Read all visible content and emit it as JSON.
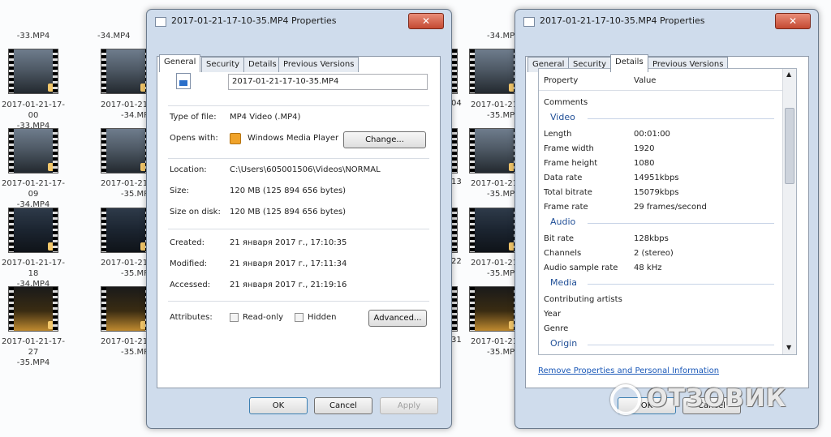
{
  "background": {
    "left_labels": [
      [
        "-33.MP4"
      ],
      [
        "2017-01-21-17-00",
        "-33.MP4"
      ],
      [
        "2017-01-21-17-09",
        "-34.MP4"
      ],
      [
        "2017-01-21-17-18",
        "-34.MP4"
      ],
      [
        "2017-01-21-17-27",
        "-35.MP4"
      ]
    ],
    "col2_labels": [
      [
        "-34.MP4"
      ],
      [
        "2017-01-21",
        "-34.MP"
      ],
      [
        "2017-01-21",
        "-35.MP"
      ],
      [
        "2017-01-21",
        "-35.MP"
      ],
      [
        "2017-01-21",
        "-35.MP"
      ]
    ],
    "mid_fragments": [
      "04",
      "13",
      "22",
      "31"
    ],
    "right_labels": [
      [
        "-34.MP"
      ],
      [
        "2017-01-21",
        "-35.MP"
      ],
      [
        "2017-01-21",
        "-35.MP"
      ],
      [
        "2017-01-21",
        "-35.MP"
      ],
      [
        "2017-01-21",
        "-35.MP"
      ]
    ]
  },
  "general_dialog": {
    "title": "2017-01-21-17-10-35.MP4 Properties",
    "close_glyph": "✕",
    "tabs": [
      "General",
      "Security",
      "Details",
      "Previous Versions"
    ],
    "filename": "2017-01-21-17-10-35.MP4",
    "type_label": "Type of file:",
    "type_value": "MP4 Video (.MP4)",
    "opens_label": "Opens with:",
    "opens_value": "Windows Media Player",
    "change_button": "Change...",
    "location_label": "Location:",
    "location_value": "C:\\Users\\605001506\\Videos\\NORMAL",
    "size_label": "Size:",
    "size_value": "120 MB (125 894 656 bytes)",
    "size_disk_label": "Size on disk:",
    "size_disk_value": "120 MB (125 894 656 bytes)",
    "created_label": "Created:",
    "created_value": "21 января 2017 г., 17:10:35",
    "modified_label": "Modified:",
    "modified_value": "21 января 2017 г., 17:11:34",
    "accessed_label": "Accessed:",
    "accessed_value": "21 января 2017 г., 21:19:16",
    "attributes_label": "Attributes:",
    "readonly_label": "Read-only",
    "hidden_label": "Hidden",
    "advanced_button": "Advanced...",
    "ok_button": "OK",
    "cancel_button": "Cancel",
    "apply_button": "Apply"
  },
  "details_dialog": {
    "title": "2017-01-21-17-10-35.MP4 Properties",
    "close_glyph": "✕",
    "tabs": [
      "General",
      "Security",
      "Details",
      "Previous Versions"
    ],
    "col_property": "Property",
    "col_value": "Value",
    "rows": [
      {
        "kind": "row",
        "prop": "Comments",
        "val": ""
      },
      {
        "kind": "section",
        "prop": "Video"
      },
      {
        "kind": "row",
        "prop": "Length",
        "val": "00:01:00"
      },
      {
        "kind": "row",
        "prop": "Frame width",
        "val": "1920"
      },
      {
        "kind": "row",
        "prop": "Frame height",
        "val": "1080"
      },
      {
        "kind": "row",
        "prop": "Data rate",
        "val": "14951kbps"
      },
      {
        "kind": "row",
        "prop": "Total bitrate",
        "val": "15079kbps"
      },
      {
        "kind": "row",
        "prop": "Frame rate",
        "val": "29 frames/second"
      },
      {
        "kind": "section",
        "prop": "Audio"
      },
      {
        "kind": "row",
        "prop": "Bit rate",
        "val": "128kbps"
      },
      {
        "kind": "row",
        "prop": "Channels",
        "val": "2 (stereo)"
      },
      {
        "kind": "row",
        "prop": "Audio sample rate",
        "val": "48 kHz"
      },
      {
        "kind": "section",
        "prop": "Media"
      },
      {
        "kind": "row",
        "prop": "Contributing artists",
        "val": ""
      },
      {
        "kind": "row",
        "prop": "Year",
        "val": ""
      },
      {
        "kind": "row",
        "prop": "Genre",
        "val": ""
      },
      {
        "kind": "section",
        "prop": "Origin"
      }
    ],
    "remove_link": "Remove Properties and Personal Information",
    "ok_button": "OK",
    "cancel_button": "Cancel"
  },
  "watermark": {
    "text": "ОТЗОВИК"
  }
}
